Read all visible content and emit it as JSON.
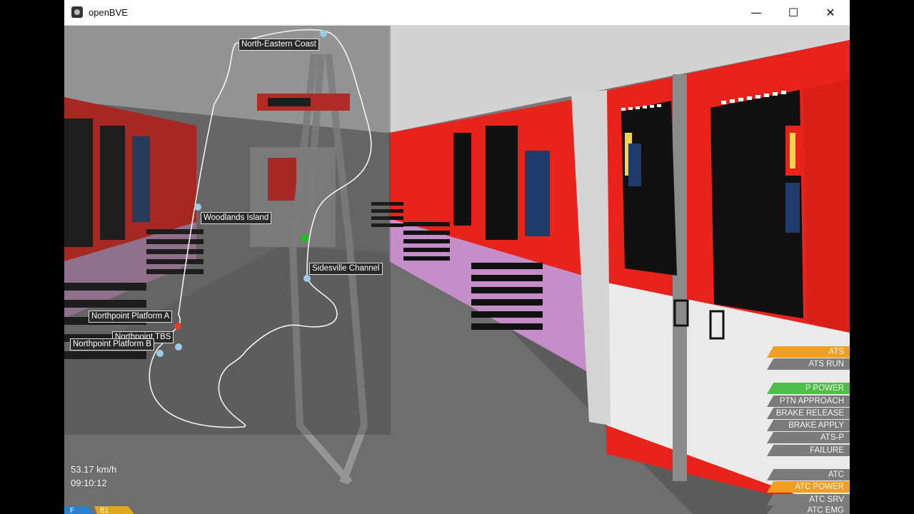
{
  "window": {
    "title": "openBVE",
    "controls": {
      "minimize": "—",
      "maximize": "☐",
      "close": "✕"
    }
  },
  "map": {
    "stations": [
      {
        "name": "North-Eastern Coast"
      },
      {
        "name": "Woodlands Island"
      },
      {
        "name": "Sidesville Channel"
      },
      {
        "name": "Northpoint Platform A"
      },
      {
        "name": "Northpoint TBS"
      },
      {
        "name": "Northpoint Platform B"
      }
    ]
  },
  "hud": {
    "speed": "53.17 km/h",
    "time": "09:10:12",
    "reverser": "F",
    "notch": "B1"
  },
  "indicators": [
    {
      "label": "ATS",
      "state": "orange"
    },
    {
      "label": "ATS RUN",
      "state": "off"
    },
    {
      "label": "P POWER",
      "state": "green"
    },
    {
      "label": "PTN APPROACH",
      "state": "off"
    },
    {
      "label": "BRAKE RELEASE",
      "state": "off"
    },
    {
      "label": "BRAKE APPLY",
      "state": "off"
    },
    {
      "label": "ATS-P",
      "state": "off"
    },
    {
      "label": "FAILURE",
      "state": "off"
    },
    {
      "label": "ATC",
      "state": "off"
    },
    {
      "label": "ATC POWER",
      "state": "orange"
    },
    {
      "label": "ATC SRV",
      "state": "off"
    },
    {
      "label": "ATC EMG",
      "state": "off"
    }
  ],
  "colors": {
    "train_red": "#e8231c",
    "signal_green": "#22bb22",
    "marker_red": "#e83c2a",
    "marker_blue": "#9ccbe8",
    "ats_orange": "#f0a020",
    "ats_green": "#4fbe48"
  }
}
